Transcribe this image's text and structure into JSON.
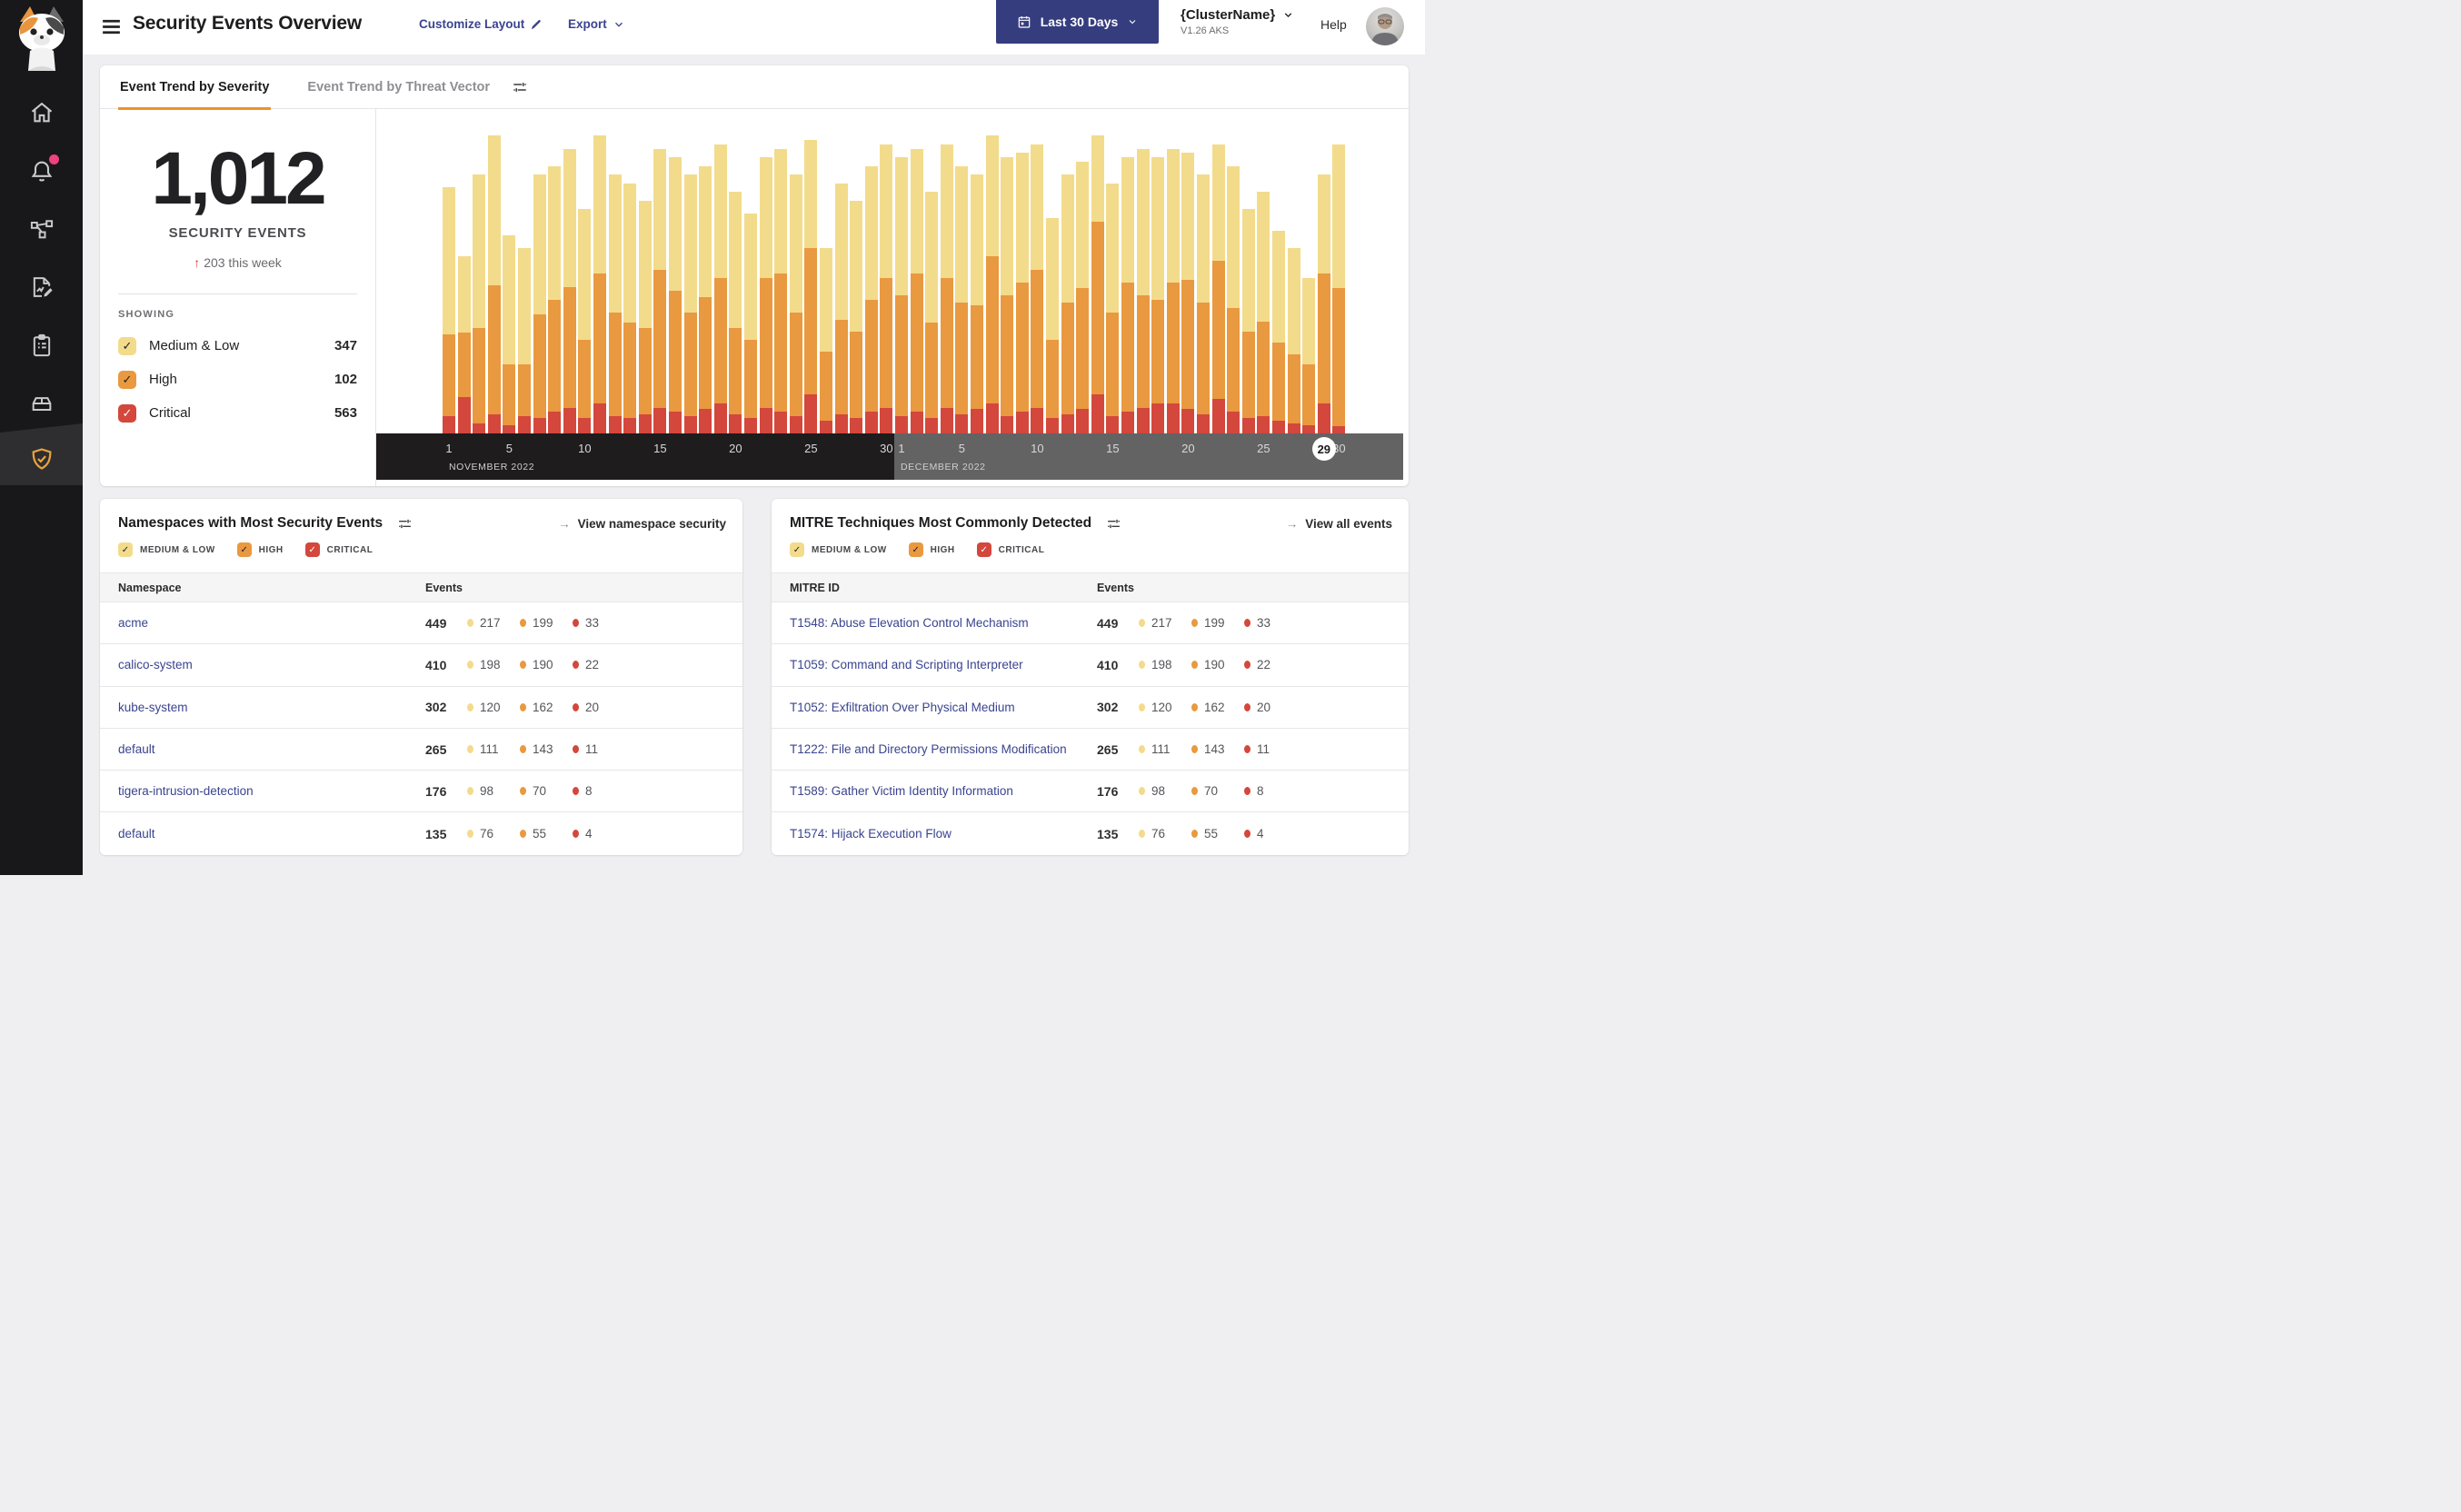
{
  "header": {
    "title": "Security Events Overview",
    "customize_layout": "Customize Layout",
    "export_label": "Export",
    "date_range": "Last 30 Days",
    "cluster_name": "{ClusterName}",
    "cluster_version": "V1.26 AKS",
    "help": "Help"
  },
  "sidebar": {
    "items": [
      "home",
      "alerts",
      "service-graph",
      "policies",
      "compliance-reports",
      "workloads",
      "threat-defense"
    ],
    "active_item": "threat-defense",
    "alert_badge": true
  },
  "tabs": {
    "severity": "Event Trend by Severity",
    "threat_vector": "Event Trend by Threat Vector"
  },
  "summary": {
    "total": "1,012",
    "label": "SECURITY EVENTS",
    "delta_arrow": "↑",
    "delta": "203 this week",
    "showing_label": "SHOWING",
    "severities": [
      {
        "label": "Medium & Low",
        "value": "347",
        "sev": "medium"
      },
      {
        "label": "High",
        "value": "102",
        "sev": "high"
      },
      {
        "label": "Critical",
        "value": "563",
        "sev": "critical"
      }
    ]
  },
  "severity_colors": {
    "medium": "#F3DB8C",
    "high": "#E9993F",
    "critical": "#D4473C"
  },
  "chart_data": {
    "type": "bar",
    "stacked": true,
    "title": "Event Trend by Severity",
    "x_unit": "day",
    "months": [
      {
        "label": "NOVEMBER 2022",
        "days": 30
      },
      {
        "label": "DECEMBER 2022",
        "days": 30
      }
    ],
    "ylim": [
      0,
      360
    ],
    "y_axis_shown": false,
    "note": "Daily stacked event counts estimated from bar heights; no y-axis labels shown in UI",
    "series": [
      {
        "name": "Critical",
        "key": "critical",
        "values": [
          20,
          42,
          12,
          22,
          10,
          20,
          18,
          25,
          30,
          18,
          35,
          20,
          18,
          22,
          30,
          25,
          20,
          28,
          35,
          22,
          18,
          30,
          25,
          20,
          45,
          15,
          22,
          18,
          25,
          30,
          20,
          25,
          18,
          30,
          22,
          28,
          35,
          20,
          25,
          30,
          18,
          22,
          28,
          45,
          20,
          25,
          30,
          35,
          35,
          28,
          22,
          40,
          25,
          18,
          20,
          15,
          12,
          10,
          35,
          8
        ]
      },
      {
        "name": "High",
        "key": "high",
        "values": [
          95,
          75,
          110,
          150,
          70,
          60,
          120,
          130,
          140,
          90,
          150,
          120,
          110,
          100,
          160,
          140,
          120,
          130,
          145,
          100,
          90,
          150,
          160,
          120,
          170,
          80,
          110,
          100,
          130,
          150,
          140,
          160,
          110,
          150,
          130,
          120,
          170,
          140,
          150,
          160,
          90,
          130,
          140,
          200,
          120,
          150,
          130,
          120,
          140,
          150,
          130,
          160,
          120,
          100,
          110,
          90,
          80,
          70,
          150,
          160
        ]
      },
      {
        "name": "Medium & Low",
        "key": "medium",
        "values": [
          170,
          88,
          178,
          173,
          150,
          135,
          162,
          155,
          160,
          152,
          160,
          160,
          162,
          148,
          140,
          155,
          160,
          152,
          155,
          158,
          147,
          140,
          145,
          160,
          125,
          120,
          158,
          152,
          155,
          155,
          160,
          145,
          152,
          155,
          158,
          152,
          140,
          160,
          150,
          145,
          142,
          148,
          147,
          100,
          150,
          145,
          170,
          165,
          155,
          147,
          148,
          135,
          165,
          142,
          150,
          130,
          123,
          100,
          115,
          167
        ]
      }
    ],
    "ticks": [
      {
        "i": 0,
        "t": "1"
      },
      {
        "i": 4,
        "t": "5"
      },
      {
        "i": 9,
        "t": "10"
      },
      {
        "i": 14,
        "t": "15"
      },
      {
        "i": 19,
        "t": "20"
      },
      {
        "i": 24,
        "t": "25"
      },
      {
        "i": 29,
        "t": "30"
      },
      {
        "i": 30,
        "t": "1"
      },
      {
        "i": 34,
        "t": "5"
      },
      {
        "i": 39,
        "t": "10"
      },
      {
        "i": 44,
        "t": "15"
      },
      {
        "i": 49,
        "t": "20"
      },
      {
        "i": 54,
        "t": "25"
      },
      {
        "i": 58,
        "t": "29",
        "circled": true
      },
      {
        "i": 59,
        "t": "30"
      }
    ],
    "highlight": {
      "index": 58,
      "label": "29"
    }
  },
  "legend": [
    {
      "label": "MEDIUM & LOW",
      "sev": "medium"
    },
    {
      "label": "HIGH",
      "sev": "high"
    },
    {
      "label": "CRITICAL",
      "sev": "critical"
    }
  ],
  "namespaces_card": {
    "title": "Namespaces with Most Security Events",
    "link_arrow": "→",
    "link": "View namespace security",
    "columns": [
      "Namespace",
      "Events"
    ],
    "rows": [
      {
        "name": "acme",
        "total": "449",
        "medium": "217",
        "high": "199",
        "critical": "33"
      },
      {
        "name": "calico-system",
        "total": "410",
        "medium": "198",
        "high": "190",
        "critical": "22"
      },
      {
        "name": "kube-system",
        "total": "302",
        "medium": "120",
        "high": "162",
        "critical": "20"
      },
      {
        "name": "default",
        "total": "265",
        "medium": "111",
        "high": "143",
        "critical": "11"
      },
      {
        "name": "tigera-intrusion-detection",
        "total": "176",
        "medium": "98",
        "high": "70",
        "critical": "8"
      },
      {
        "name": "default",
        "total": "135",
        "medium": "76",
        "high": "55",
        "critical": "4"
      }
    ]
  },
  "mitre_card": {
    "title": "MITRE Techniques Most Commonly Detected",
    "link_arrow": "→",
    "link": "View all events",
    "columns": [
      "MITRE ID",
      "Events"
    ],
    "rows": [
      {
        "name": "T1548: Abuse Elevation Control Mechanism",
        "total": "449",
        "medium": "217",
        "high": "199",
        "critical": "33"
      },
      {
        "name": "T1059: Command and Scripting Interpreter",
        "total": "410",
        "medium": "198",
        "high": "190",
        "critical": "22"
      },
      {
        "name": "T1052: Exfiltration Over Physical Medium",
        "total": "302",
        "medium": "120",
        "high": "162",
        "critical": "20"
      },
      {
        "name": "T1222: File and Directory Permissions Modification",
        "total": "265",
        "medium": "111",
        "high": "143",
        "critical": "11"
      },
      {
        "name": "T1589: Gather Victim Identity Information",
        "total": "176",
        "medium": "98",
        "high": "70",
        "critical": "8"
      },
      {
        "name": "T1574: Hijack Execution Flow",
        "total": "135",
        "medium": "76",
        "high": "55",
        "critical": "4"
      }
    ]
  }
}
